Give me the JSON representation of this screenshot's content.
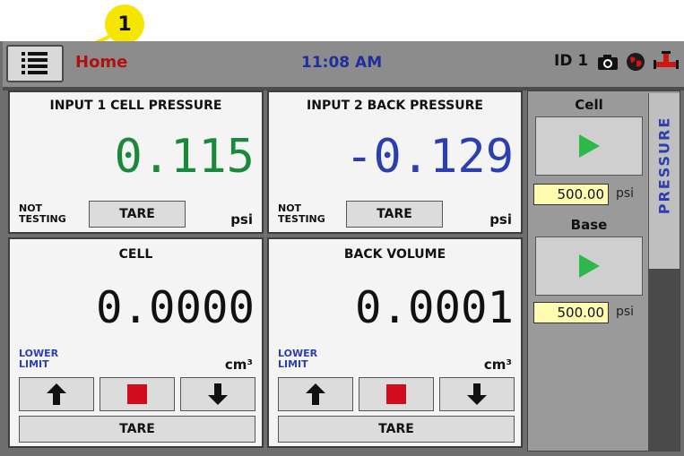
{
  "callout": {
    "number": "1"
  },
  "header": {
    "home_label": "Home",
    "time": "11:08 AM",
    "id_label": "ID 1"
  },
  "colors": {
    "header_bg": "#8c8c8c",
    "pressure_value": "#1a8a3a",
    "back_pressure_value": "#2c3fb0",
    "home_red": "#b01010",
    "setpoint_bg": "#fffbb0",
    "play_green": "#2db84a",
    "stop_red": "#d10c1c"
  },
  "panels": {
    "input1": {
      "title": "INPUT 1 CELL PRESSURE",
      "value": "0.115",
      "status_line1": "NOT",
      "status_line2": "TESTING",
      "tare": "TARE",
      "unit": "psi"
    },
    "input2": {
      "title": "INPUT 2 BACK PRESSURE",
      "value": "-0.129",
      "status_line1": "NOT",
      "status_line2": "TESTING",
      "tare": "TARE",
      "unit": "psi"
    },
    "cell_volume": {
      "title": "CELL",
      "value": "0.0000",
      "limit_line1": "LOWER",
      "limit_line2": "LIMIT",
      "unit": "cm³",
      "tare": "TARE"
    },
    "back_volume": {
      "title": "BACK VOLUME",
      "value": "0.0001",
      "limit_line1": "LOWER",
      "limit_line2": "LIMIT",
      "unit": "cm³",
      "tare": "TARE"
    }
  },
  "side": {
    "cell_label": "Cell",
    "cell_setpoint": "500.00",
    "cell_unit": "psi",
    "base_label": "Base",
    "base_setpoint": "500.00",
    "base_unit": "psi",
    "tab_label": "PRESSURE"
  },
  "icons": [
    "menu-icon",
    "camera-icon",
    "globe-icon",
    "valve-icon",
    "play-icon",
    "up-arrow-icon",
    "stop-icon",
    "down-arrow-icon"
  ]
}
